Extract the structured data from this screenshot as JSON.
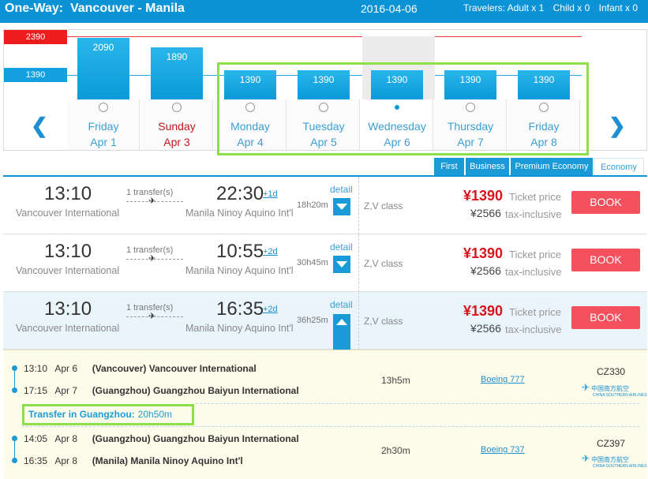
{
  "header": {
    "route": "One-Way:  Vancouver - Manila",
    "date": "2016-04-06",
    "travelers": "Travelers: Adult x 1",
    "child": "Child x 0",
    "infant": "Infant x 0"
  },
  "chart": {
    "ref_high": "2390",
    "ref_low": "1390",
    "bars": [
      {
        "price": "2090",
        "day": "Friday",
        "date": "Apr 1",
        "red": false,
        "selected": false
      },
      {
        "price": "1890",
        "day": "Sunday",
        "date": "Apr 3",
        "red": true,
        "selected": false
      },
      {
        "price": "1390",
        "day": "Monday",
        "date": "Apr 4",
        "red": false,
        "selected": false
      },
      {
        "price": "1390",
        "day": "Tuesday",
        "date": "Apr 5",
        "red": false,
        "selected": false
      },
      {
        "price": "1390",
        "day": "Wednesday",
        "date": "Apr 6",
        "red": false,
        "selected": true
      },
      {
        "price": "1390",
        "day": "Thursday",
        "date": "Apr 7",
        "red": false,
        "selected": false
      },
      {
        "price": "1390",
        "day": "Friday",
        "date": "Apr 8",
        "red": false,
        "selected": false
      }
    ],
    "prev_icon": "chevron-left-icon",
    "next_icon": "chevron-right-icon"
  },
  "tabs": [
    "First",
    "Business",
    "Premium Economy",
    "Economy"
  ],
  "flights": [
    {
      "dep_time": "13:10",
      "dep_airport": "Vancouver International",
      "transfers": "1 transfer(s)",
      "arr_time": "22:30",
      "plus_day": "+1d",
      "arr_airport": "Manila Ninoy Aquino Int'l",
      "detail": "detail",
      "duration": "18h20m",
      "class": "Z,V class",
      "price": "¥1390",
      "price_label": "Ticket price",
      "tax": "¥2566",
      "tax_label": "tax-inclusive",
      "book": "BOOK"
    },
    {
      "dep_time": "13:10",
      "dep_airport": "Vancouver International",
      "transfers": "1 transfer(s)",
      "arr_time": "10:55",
      "plus_day": "+2d",
      "arr_airport": "Manila Ninoy Aquino Int'l",
      "detail": "detail",
      "duration": "30h45m",
      "class": "Z,V class",
      "price": "¥1390",
      "price_label": "Ticket price",
      "tax": "¥2566",
      "tax_label": "tax-inclusive",
      "book": "BOOK"
    },
    {
      "dep_time": "13:10",
      "dep_airport": "Vancouver International",
      "transfers": "1 transfer(s)",
      "arr_time": "16:35",
      "plus_day": "+2d",
      "arr_airport": "Manila Ninoy Aquino Int'l",
      "detail": "detail",
      "duration": "36h25m",
      "class": "Z,V class",
      "price": "¥1390",
      "price_label": "Ticket price",
      "tax": "¥2566",
      "tax_label": "tax-inclusive",
      "book": "BOOK"
    }
  ],
  "detail_panel": {
    "legs": [
      {
        "dep_time": "13:10",
        "dep_date": "Apr 6",
        "dep_airport": "(Vancouver) Vancouver International",
        "arr_time": "17:15",
        "arr_date": "Apr 7",
        "arr_airport": "(Guangzhou) Guangzhou Baiyun International",
        "duration": "13h5m",
        "aircraft": "Boeing 777",
        "flight_no": "CZ330"
      },
      {
        "dep_time": "14:05",
        "dep_date": "Apr 8",
        "dep_airport": "(Guangzhou) Guangzhou Baiyun International",
        "arr_time": "16:35",
        "arr_date": "Apr 8",
        "arr_airport": "(Manila) Manila Ninoy Aquino Int'l",
        "duration": "2h30m",
        "aircraft": "Boeing 737",
        "flight_no": "CZ397"
      }
    ],
    "transfer_label": "Transfer in Guangzhou:",
    "transfer_time": "20h50m",
    "airline_logo_text": "中国南方航空",
    "airline_logo_sub": "CHINA SOUTHERN AIRLINES"
  },
  "colors": {
    "header_blue": "#0b93d6",
    "bar_blue": "#0a9ad8",
    "price_red": "#d9141c",
    "book_red": "#f4505d",
    "highlight_green": "#8de04c"
  }
}
